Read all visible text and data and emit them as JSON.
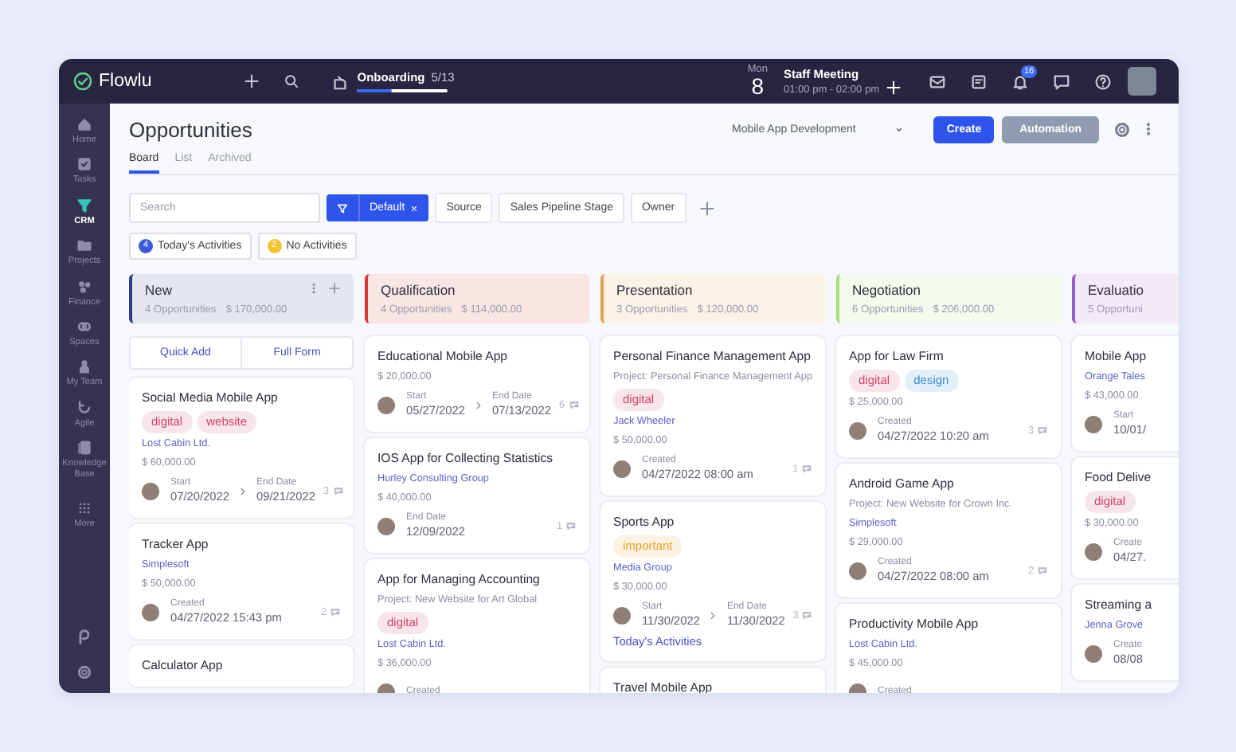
{
  "topbar": {
    "logo": "Flowlu",
    "onboarding": {
      "label": "Onboarding",
      "progress": "5/13",
      "level": 0.38
    },
    "event": {
      "weekday": "Mon",
      "day": "8",
      "title": "Staff Meeting",
      "time": "01:00 pm - 02:00 pm"
    },
    "notifications": "16"
  },
  "sidebar": {
    "items": [
      {
        "label": "Home",
        "selected": false
      },
      {
        "label": "Tasks",
        "selected": false
      },
      {
        "label": "CRM",
        "selected": true
      },
      {
        "label": "Projects",
        "selected": false
      },
      {
        "label": "Finance",
        "selected": false
      },
      {
        "label": "Spaces",
        "selected": false
      },
      {
        "label": "My Team",
        "selected": false
      },
      {
        "label": "Agile",
        "selected": false
      },
      {
        "label": "Knowledge Base",
        "selected": false
      },
      {
        "label": "More",
        "selected": false
      }
    ]
  },
  "header": {
    "title": "Opportunities",
    "tabs": [
      {
        "label": "Board",
        "selected": true
      },
      {
        "label": "List",
        "selected": false
      },
      {
        "label": "Archived",
        "selected": false
      }
    ],
    "pipeline": "Mobile App Development",
    "buttons": [
      {
        "label": "Create",
        "kind": "primary"
      },
      {
        "label": "Automation",
        "kind": "secondary"
      }
    ]
  },
  "filters": {
    "search": {
      "placeholder": "Search"
    },
    "preset": "Default",
    "fields": [
      "Source",
      "Sales Pipeline Stage",
      "Owner"
    ],
    "activities": [
      {
        "count": "4",
        "label": "Today's Activities",
        "color": "#3d5bd9"
      },
      {
        "count": "2",
        "label": "No Activities",
        "color": "#f2c230"
      }
    ]
  },
  "columns": [
    {
      "title": "New",
      "count": "4 Opportunities",
      "amount": "$ 170,000.00",
      "color": "#2f3b8c",
      "menu": true,
      "actions": [
        "Quick Add",
        "Full Form"
      ],
      "cards": [
        {
          "title": "Social Media Mobile App",
          "tags": [
            {
              "label": "digital",
              "color": "#d0436c"
            },
            {
              "label": "website",
              "color": "#d0436c"
            }
          ],
          "company": "Lost Cabin Ltd.",
          "amount": "$ 60,000.00",
          "dates": [
            {
              "label": "Start",
              "value": "07/20/2022"
            },
            {
              "label": "End Date",
              "value": "09/21/2022"
            }
          ],
          "comments": "3"
        },
        {
          "title": "Tracker App",
          "company": "Simplesoft",
          "amount": "$ 50,000.00",
          "dates": [
            {
              "label": "Created",
              "value": "04/27/2022 15:43 pm"
            }
          ],
          "comments": "2"
        },
        {
          "title": "Calculator App"
        }
      ]
    },
    {
      "title": "Qualification",
      "count": "4 Opportunities",
      "amount": "$ 114,000.00",
      "color": "#d9383a",
      "menu": false,
      "cards": [
        {
          "title": "Educational Mobile App",
          "amount": "$ 20,000.00",
          "dates": [
            {
              "label": "Start",
              "value": "05/27/2022"
            },
            {
              "label": "End Date",
              "value": "07/13/2022"
            }
          ],
          "comments": "6"
        },
        {
          "title": "IOS App for Collecting Statistics",
          "company": "Hurley Consulting Group",
          "amount": "$ 40,000.00",
          "dates": [
            {
              "label": "End Date",
              "value": "12/09/2022"
            }
          ],
          "comments": "1"
        },
        {
          "title": "App for Managing Accounting",
          "project": "Project: New Website for Art Global",
          "tags": [
            {
              "label": "digital",
              "color": "#d0436c"
            }
          ],
          "company": "Lost Cabin Ltd.",
          "amount": "$ 36,000.00",
          "dates": [
            {
              "label": "Created"
            }
          ]
        }
      ]
    },
    {
      "title": "Presentation",
      "count": "3 Opportunities",
      "amount": "$ 120,000.00",
      "color": "#e0a14c",
      "menu": false,
      "cards": [
        {
          "title": "Personal Finance Management App",
          "project": "Project: Personal Finance Management App",
          "tags": [
            {
              "label": "digital",
              "color": "#d0436c"
            }
          ],
          "company": "Jack Wheeler",
          "amount": "$ 50,000.00",
          "dates": [
            {
              "label": "Created",
              "value": "04/27/2022 08:00 am"
            }
          ],
          "comments": "1"
        },
        {
          "title": "Sports App",
          "tags": [
            {
              "label": "important",
              "color": "#e3a52c"
            }
          ],
          "company": "Media Group",
          "amount": "$ 30,000.00",
          "dates": [
            {
              "label": "Start",
              "value": "11/30/2022"
            },
            {
              "label": "End Date",
              "value": "11/30/2022"
            }
          ],
          "comments": "3",
          "link": "Today's Activities"
        },
        {
          "title": "Travel Mobile App"
        }
      ]
    },
    {
      "title": "Negotiation",
      "count": "6 Opportunities",
      "amount": "$ 206,000.00",
      "color": "#a8dc7c",
      "menu": false,
      "cards": [
        {
          "title": "App for Law Firm",
          "tags": [
            {
              "label": "digital",
              "color": "#d0436c"
            },
            {
              "label": "design",
              "color": "#3a8fd0"
            }
          ],
          "amount": "$ 25,000.00",
          "dates": [
            {
              "label": "Created",
              "value": "04/27/2022 10:20 am"
            }
          ],
          "comments": "3"
        },
        {
          "title": "Android Game App",
          "project": "Project: New Website for Crown Inc.",
          "company": "Simplesoft",
          "amount": "$ 29,000.00",
          "dates": [
            {
              "label": "Created",
              "value": "04/27/2022 08:00 am"
            }
          ],
          "comments": "2"
        },
        {
          "title": "Productivity Mobile App",
          "company": "Lost Cabin Ltd.",
          "amount": "$ 45,000.00",
          "dates": [
            {
              "label": "Created"
            }
          ]
        }
      ]
    },
    {
      "title": "Evaluatio",
      "count": "5 Opportuni",
      "color": "#9b59d0",
      "menu": false,
      "cards": [
        {
          "title": "Mobile App",
          "company": "Orange Tales",
          "amount": "$ 43,000.00",
          "dates": [
            {
              "label": "Start",
              "value": "10/01/"
            }
          ]
        },
        {
          "title": "Food Delive",
          "tags": [
            {
              "label": "digital",
              "color": "#d0436c"
            }
          ],
          "amount": "$ 30,000.00",
          "dates": [
            {
              "label": "Create",
              "value": "04/27."
            }
          ]
        },
        {
          "title": "Streaming a",
          "company": "Jenna Grove",
          "dates": [
            {
              "label": "Create",
              "value": "08/08"
            }
          ]
        }
      ]
    }
  ]
}
